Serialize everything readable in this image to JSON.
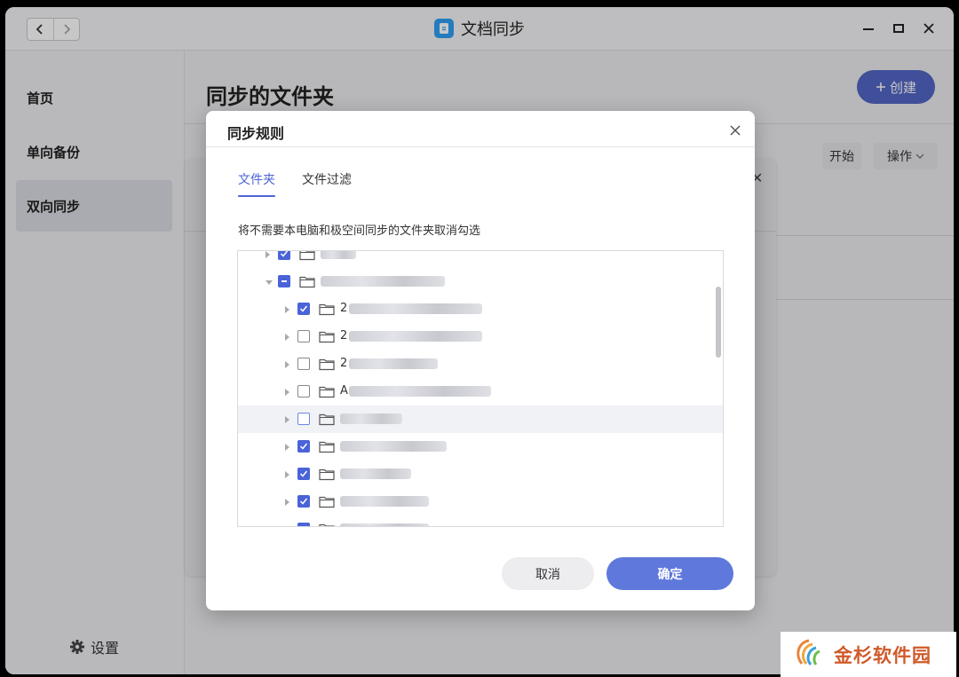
{
  "window": {
    "title": "文档同步",
    "icons": {
      "app": "document-sync-icon",
      "back": "chevron-left-icon",
      "forward": "chevron-right-icon",
      "minimize": "minimize-icon",
      "maximize": "maximize-icon",
      "close": "close-icon"
    }
  },
  "sidebar": {
    "items": [
      {
        "label": "首页",
        "active": false
      },
      {
        "label": "单向备份",
        "active": false
      },
      {
        "label": "双向同步",
        "active": true
      }
    ],
    "settings_label": "设置"
  },
  "main": {
    "title": "同步的文件夹",
    "create_button": "创建",
    "start_button": "开始",
    "ops_button": "操作"
  },
  "dialog": {
    "title": "同步规则",
    "tabs": [
      {
        "label": "文件夹",
        "active": true
      },
      {
        "label": "文件过滤",
        "active": false
      }
    ],
    "hint": "将不需要本电脑和极空间同步的文件夹取消勾选",
    "tree": [
      {
        "indent": 0,
        "state": "checked",
        "expanded": false,
        "visible_text": ""
      },
      {
        "indent": 0,
        "state": "indeterminate",
        "expanded": true,
        "visible_text": ""
      },
      {
        "indent": 1,
        "state": "checked",
        "expanded": false,
        "visible_text": "2"
      },
      {
        "indent": 1,
        "state": "unchecked",
        "expanded": false,
        "visible_text": "2"
      },
      {
        "indent": 1,
        "state": "unchecked",
        "expanded": false,
        "visible_text": "2"
      },
      {
        "indent": 1,
        "state": "unchecked",
        "expanded": false,
        "visible_text": "A"
      },
      {
        "indent": 1,
        "state": "unchecked",
        "expanded": false,
        "visible_text": "",
        "hover": true
      },
      {
        "indent": 1,
        "state": "checked",
        "expanded": false,
        "visible_text": ""
      },
      {
        "indent": 1,
        "state": "checked",
        "expanded": false,
        "visible_text": ""
      },
      {
        "indent": 1,
        "state": "checked",
        "expanded": false,
        "visible_text": ""
      },
      {
        "indent": 1,
        "state": "checked",
        "expanded": false,
        "visible_text": ""
      }
    ],
    "cancel_button": "取消",
    "ok_button": "确定"
  },
  "watermark": {
    "text": "金杉软件园"
  },
  "colors": {
    "accent": "#4b63d6",
    "primary_button": "#5f78dc",
    "create_button": "#5266c4"
  }
}
